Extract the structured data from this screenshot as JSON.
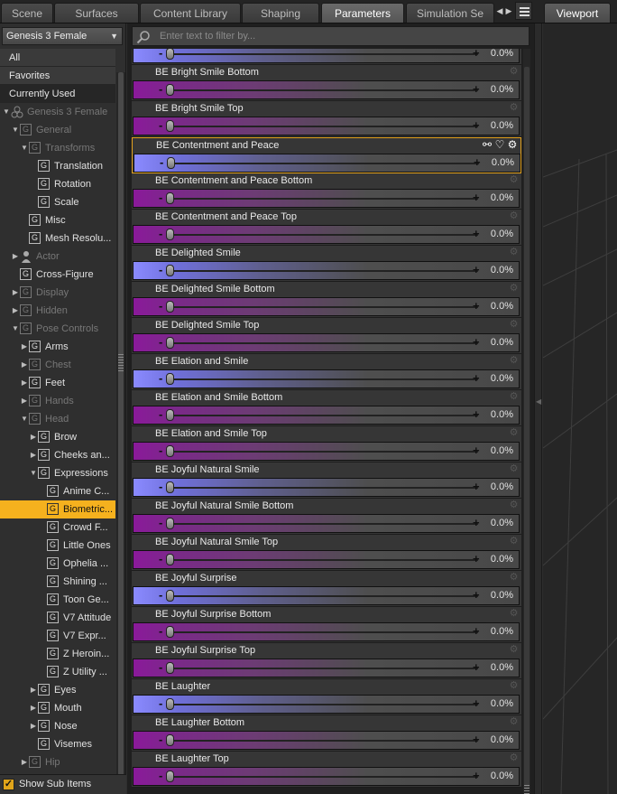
{
  "tabs": [
    {
      "label": "Scene",
      "active": false
    },
    {
      "label": "Surfaces",
      "active": false
    },
    {
      "label": "Content Library",
      "active": false
    },
    {
      "label": "Shaping",
      "active": false
    },
    {
      "label": "Parameters",
      "active": true
    },
    {
      "label": "Simulation Se",
      "active": false
    }
  ],
  "viewport_tab": "Viewport",
  "figure_select": "Genesis 3 Female",
  "filters": [
    "All",
    "Favorites",
    "Currently Used"
  ],
  "tree": [
    {
      "label": "Genesis 3 Female",
      "dim": true
    },
    {
      "label": "General",
      "dim": true
    },
    {
      "label": "Transforms",
      "dim": true
    },
    {
      "label": "Translation",
      "dim": false
    },
    {
      "label": "Rotation",
      "dim": false
    },
    {
      "label": "Scale",
      "dim": false
    },
    {
      "label": "Misc",
      "dim": false
    },
    {
      "label": "Mesh Resolu...",
      "dim": false
    },
    {
      "label": "Actor",
      "dim": true
    },
    {
      "label": "Cross-Figure",
      "dim": false
    },
    {
      "label": "Display",
      "dim": true
    },
    {
      "label": "Hidden",
      "dim": true
    },
    {
      "label": "Pose Controls",
      "dim": true
    },
    {
      "label": "Arms",
      "dim": false
    },
    {
      "label": "Chest",
      "dim": true
    },
    {
      "label": "Feet",
      "dim": false
    },
    {
      "label": "Hands",
      "dim": true
    },
    {
      "label": "Head",
      "dim": true
    },
    {
      "label": "Brow",
      "dim": false
    },
    {
      "label": "Cheeks an...",
      "dim": false
    },
    {
      "label": "Expressions",
      "dim": false
    },
    {
      "label": "Anime C...",
      "dim": false
    },
    {
      "label": "Biometric...",
      "dim": false,
      "selected": true
    },
    {
      "label": "Crowd F...",
      "dim": false
    },
    {
      "label": "Little Ones",
      "dim": false
    },
    {
      "label": "Ophelia ...",
      "dim": false
    },
    {
      "label": "Shining ...",
      "dim": false
    },
    {
      "label": "Toon Ge...",
      "dim": false
    },
    {
      "label": "V7 Attitude",
      "dim": false
    },
    {
      "label": "V7 Expr...",
      "dim": false
    },
    {
      "label": "Z Heroin...",
      "dim": false
    },
    {
      "label": "Z Utility ...",
      "dim": false
    },
    {
      "label": "Eyes",
      "dim": false
    },
    {
      "label": "Mouth",
      "dim": false
    },
    {
      "label": "Nose",
      "dim": false
    },
    {
      "label": "Visemes",
      "dim": false
    },
    {
      "label": "Hip",
      "dim": true
    }
  ],
  "show_sub_items": "Show Sub Items",
  "filter_placeholder": "Enter text to filter by...",
  "first_value": "0.0%",
  "params": [
    {
      "name": "BE Bright Smile Bottom",
      "value": "0.0%",
      "color": "purple"
    },
    {
      "name": "BE Bright Smile Top",
      "value": "0.0%",
      "color": "purple"
    },
    {
      "name": "BE Contentment and Peace",
      "value": "0.0%",
      "color": "blue",
      "selected": true
    },
    {
      "name": "BE Contentment and Peace Bottom",
      "value": "0.0%",
      "color": "purple"
    },
    {
      "name": "BE Contentment and Peace Top",
      "value": "0.0%",
      "color": "purple"
    },
    {
      "name": "BE Delighted Smile",
      "value": "0.0%",
      "color": "blue"
    },
    {
      "name": "BE Delighted Smile Bottom",
      "value": "0.0%",
      "color": "purple"
    },
    {
      "name": "BE Delighted Smile Top",
      "value": "0.0%",
      "color": "purple"
    },
    {
      "name": "BE Elation and Smile",
      "value": "0.0%",
      "color": "blue"
    },
    {
      "name": "BE Elation and Smile Bottom",
      "value": "0.0%",
      "color": "purple"
    },
    {
      "name": "BE Elation and Smile Top",
      "value": "0.0%",
      "color": "purple"
    },
    {
      "name": "BE Joyful Natural Smile",
      "value": "0.0%",
      "color": "blue"
    },
    {
      "name": "BE Joyful Natural Smile Bottom",
      "value": "0.0%",
      "color": "purple"
    },
    {
      "name": "BE Joyful Natural Smile Top",
      "value": "0.0%",
      "color": "purple"
    },
    {
      "name": "BE Joyful Surprise",
      "value": "0.0%",
      "color": "blue"
    },
    {
      "name": "BE Joyful Surprise Bottom",
      "value": "0.0%",
      "color": "purple"
    },
    {
      "name": "BE Joyful Surprise Top",
      "value": "0.0%",
      "color": "purple"
    },
    {
      "name": "BE Laughter",
      "value": "0.0%",
      "color": "blue"
    },
    {
      "name": "BE Laughter Bottom",
      "value": "0.0%",
      "color": "purple"
    },
    {
      "name": "BE Laughter Top",
      "value": "0.0%",
      "color": "purple"
    }
  ],
  "colors": {
    "accent": "#f5b11e",
    "slider_purple": "#8a1a9a",
    "slider_blue": "#8a8aff"
  }
}
